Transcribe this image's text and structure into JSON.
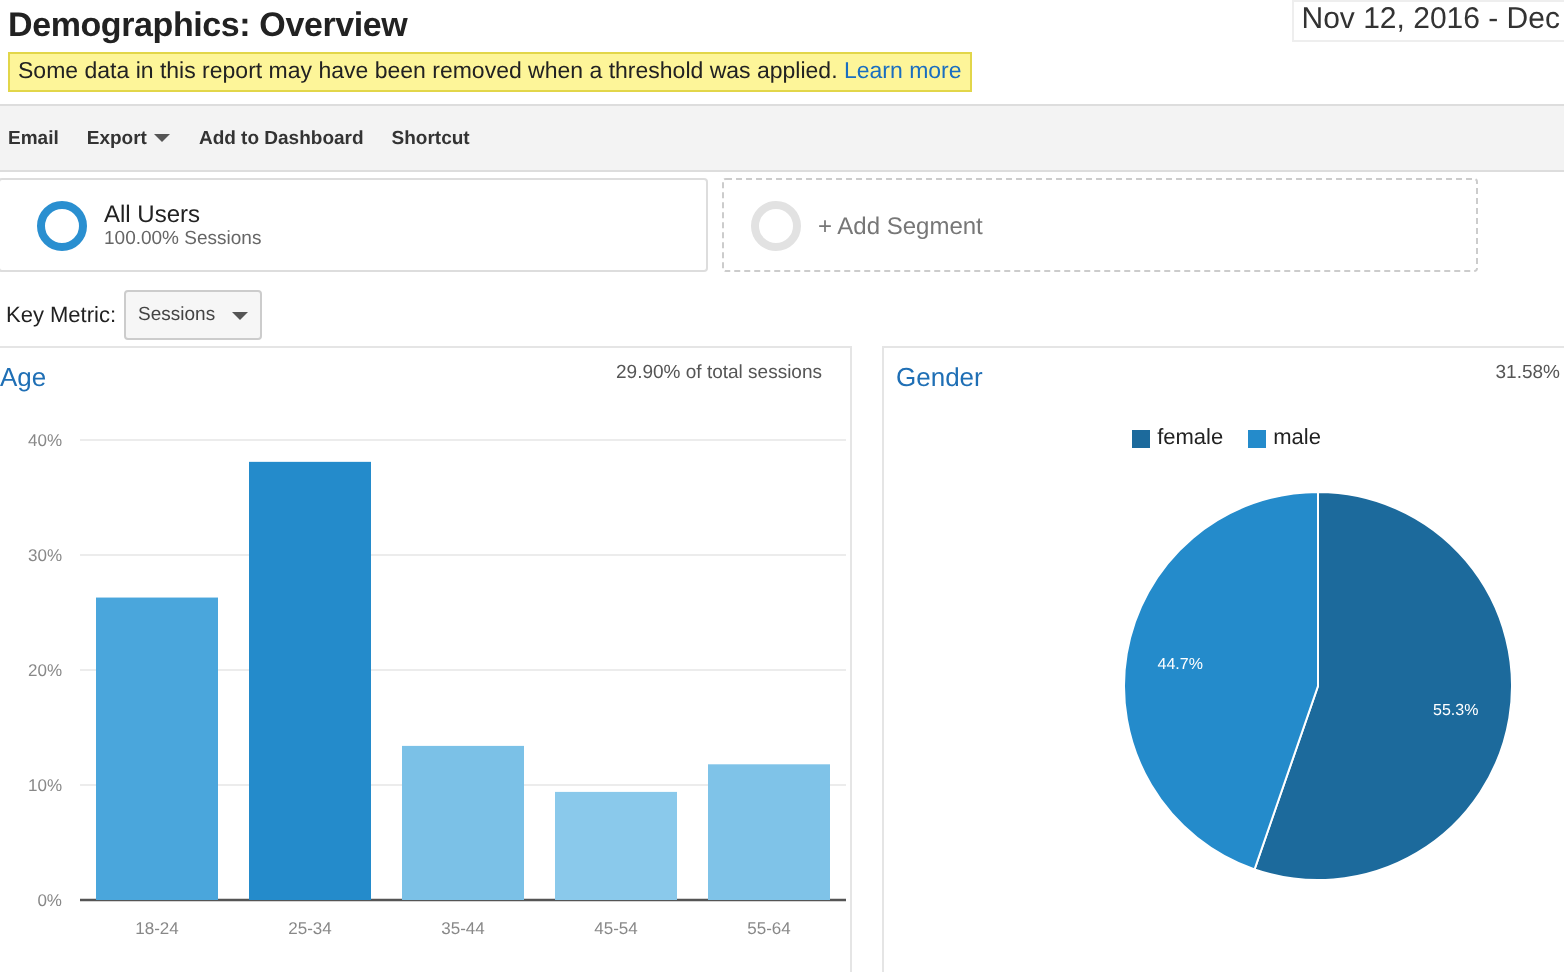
{
  "page": {
    "title": "Demographics: Overview",
    "date_range": "Nov 12, 2016 - Dec"
  },
  "notice": {
    "text": "Some data in this report may have been removed when a threshold was applied.",
    "link": "Learn more"
  },
  "toolbar": [
    {
      "label": "Email",
      "caret": false
    },
    {
      "label": "Export",
      "caret": true
    },
    {
      "label": "Add to Dashboard",
      "caret": false
    },
    {
      "label": "Shortcut",
      "caret": false
    }
  ],
  "segments": [
    {
      "kind": "active",
      "name": "All Users",
      "detail": "100.00% Sessions"
    },
    {
      "kind": "add",
      "name": "+ Add Segment"
    }
  ],
  "key_metric": {
    "label": "Key Metric:",
    "value": "Sessions"
  },
  "age": {
    "title": "Age",
    "share": "29.90% of total sessions",
    "chart_data": {
      "type": "bar",
      "categories": [
        "18-24",
        "25-34",
        "35-44",
        "45-54",
        "55-64"
      ],
      "values": [
        26.3,
        38.1,
        13.4,
        9.4,
        11.8
      ],
      "colors": [
        "#4aa6dc",
        "#248bcb",
        "#7bc1e7",
        "#8ac9eb",
        "#7fc3e8"
      ],
      "grid": true,
      "ylim": [
        0,
        40
      ],
      "yticks": [
        {
          "value": 0,
          "label": "0%"
        },
        {
          "value": 10,
          "label": "10%"
        },
        {
          "value": 20,
          "label": "20%"
        },
        {
          "value": 30,
          "label": "30%"
        },
        {
          "value": 40,
          "label": "40%"
        }
      ]
    }
  },
  "gender": {
    "title": "Gender",
    "share": "31.58%",
    "chart_data": {
      "type": "pie",
      "categories": [
        "female",
        "male"
      ],
      "values": [
        55.3,
        44.7
      ],
      "colors": [
        "#1c6a9c",
        "#248bcb"
      ],
      "value_labels": [
        "55.3%",
        "44.7%"
      ]
    }
  }
}
